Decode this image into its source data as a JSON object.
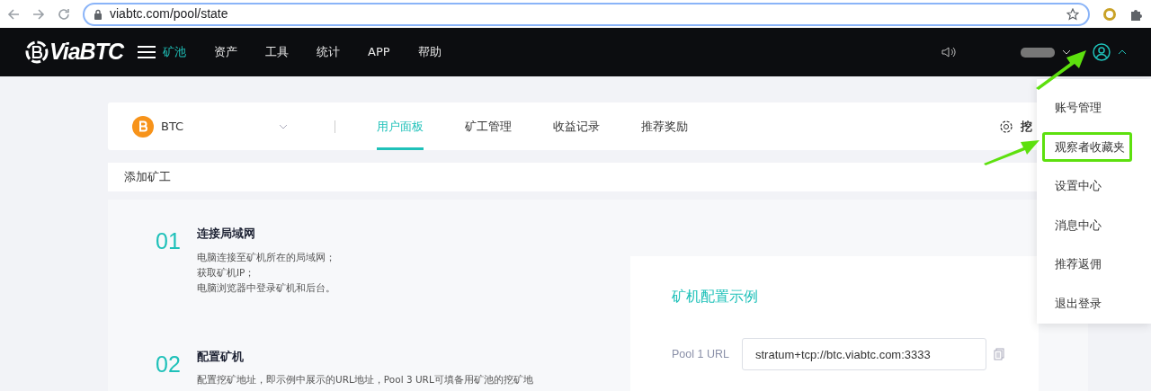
{
  "browser": {
    "url": "viabtc.com/pool/state"
  },
  "navbar": {
    "logo": "ViaBTC",
    "menu": [
      {
        "label": "矿池",
        "selected": true
      },
      {
        "label": "资产",
        "selected": false
      },
      {
        "label": "工具",
        "selected": false
      },
      {
        "label": "统计",
        "selected": false
      },
      {
        "label": "APP",
        "selected": false
      },
      {
        "label": "帮助",
        "selected": false
      }
    ],
    "user_menu_expanded": true
  },
  "coin_bar": {
    "coin": "BTC",
    "tabs": [
      {
        "label": "用户面板",
        "selected": true
      },
      {
        "label": "矿工管理",
        "selected": false
      },
      {
        "label": "收益记录",
        "selected": false
      },
      {
        "label": "推荐奖励",
        "selected": false
      }
    ],
    "settings_label": "挖"
  },
  "sub_bar": {
    "title": "添加矿工"
  },
  "steps": [
    {
      "number": "01",
      "title": "连接局域网",
      "lines": [
        "电脑连接至矿机所在的局域网；",
        "获取矿机IP；",
        "电脑浏览器中登录矿机和后台。"
      ]
    },
    {
      "number": "02",
      "title": "配置矿机",
      "lines": [
        "配置挖矿地址，即示例中展示的URL地址，Pool 3 URL可填备用矿池的挖矿地"
      ]
    }
  ],
  "config_example": {
    "title": "矿机配置示例",
    "fields": [
      {
        "label": "Pool 1 URL",
        "value": "stratum+tcp://btc.viabtc.com:3333"
      }
    ]
  },
  "user_menu": {
    "items": [
      {
        "label": "账号管理",
        "highlighted": false
      },
      {
        "label": "观察者收藏夹",
        "highlighted": true
      },
      {
        "label": "设置中心",
        "highlighted": false
      },
      {
        "label": "消息中心",
        "highlighted": false
      },
      {
        "label": "推荐返佣",
        "highlighted": false
      },
      {
        "label": "退出登录",
        "highlighted": false
      }
    ]
  }
}
